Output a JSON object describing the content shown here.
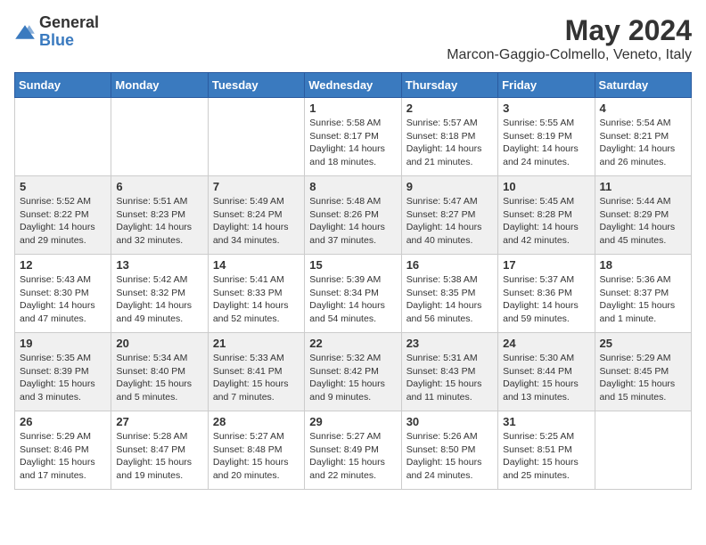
{
  "logo": {
    "general": "General",
    "blue": "Blue"
  },
  "title": "May 2024",
  "location": "Marcon-Gaggio-Colmello, Veneto, Italy",
  "days_of_week": [
    "Sunday",
    "Monday",
    "Tuesday",
    "Wednesday",
    "Thursday",
    "Friday",
    "Saturday"
  ],
  "weeks": [
    [
      {
        "day": "",
        "info": ""
      },
      {
        "day": "",
        "info": ""
      },
      {
        "day": "",
        "info": ""
      },
      {
        "day": "1",
        "info": "Sunrise: 5:58 AM\nSunset: 8:17 PM\nDaylight: 14 hours\nand 18 minutes."
      },
      {
        "day": "2",
        "info": "Sunrise: 5:57 AM\nSunset: 8:18 PM\nDaylight: 14 hours\nand 21 minutes."
      },
      {
        "day": "3",
        "info": "Sunrise: 5:55 AM\nSunset: 8:19 PM\nDaylight: 14 hours\nand 24 minutes."
      },
      {
        "day": "4",
        "info": "Sunrise: 5:54 AM\nSunset: 8:21 PM\nDaylight: 14 hours\nand 26 minutes."
      }
    ],
    [
      {
        "day": "5",
        "info": "Sunrise: 5:52 AM\nSunset: 8:22 PM\nDaylight: 14 hours\nand 29 minutes."
      },
      {
        "day": "6",
        "info": "Sunrise: 5:51 AM\nSunset: 8:23 PM\nDaylight: 14 hours\nand 32 minutes."
      },
      {
        "day": "7",
        "info": "Sunrise: 5:49 AM\nSunset: 8:24 PM\nDaylight: 14 hours\nand 34 minutes."
      },
      {
        "day": "8",
        "info": "Sunrise: 5:48 AM\nSunset: 8:26 PM\nDaylight: 14 hours\nand 37 minutes."
      },
      {
        "day": "9",
        "info": "Sunrise: 5:47 AM\nSunset: 8:27 PM\nDaylight: 14 hours\nand 40 minutes."
      },
      {
        "day": "10",
        "info": "Sunrise: 5:45 AM\nSunset: 8:28 PM\nDaylight: 14 hours\nand 42 minutes."
      },
      {
        "day": "11",
        "info": "Sunrise: 5:44 AM\nSunset: 8:29 PM\nDaylight: 14 hours\nand 45 minutes."
      }
    ],
    [
      {
        "day": "12",
        "info": "Sunrise: 5:43 AM\nSunset: 8:30 PM\nDaylight: 14 hours\nand 47 minutes."
      },
      {
        "day": "13",
        "info": "Sunrise: 5:42 AM\nSunset: 8:32 PM\nDaylight: 14 hours\nand 49 minutes."
      },
      {
        "day": "14",
        "info": "Sunrise: 5:41 AM\nSunset: 8:33 PM\nDaylight: 14 hours\nand 52 minutes."
      },
      {
        "day": "15",
        "info": "Sunrise: 5:39 AM\nSunset: 8:34 PM\nDaylight: 14 hours\nand 54 minutes."
      },
      {
        "day": "16",
        "info": "Sunrise: 5:38 AM\nSunset: 8:35 PM\nDaylight: 14 hours\nand 56 minutes."
      },
      {
        "day": "17",
        "info": "Sunrise: 5:37 AM\nSunset: 8:36 PM\nDaylight: 14 hours\nand 59 minutes."
      },
      {
        "day": "18",
        "info": "Sunrise: 5:36 AM\nSunset: 8:37 PM\nDaylight: 15 hours\nand 1 minute."
      }
    ],
    [
      {
        "day": "19",
        "info": "Sunrise: 5:35 AM\nSunset: 8:39 PM\nDaylight: 15 hours\nand 3 minutes."
      },
      {
        "day": "20",
        "info": "Sunrise: 5:34 AM\nSunset: 8:40 PM\nDaylight: 15 hours\nand 5 minutes."
      },
      {
        "day": "21",
        "info": "Sunrise: 5:33 AM\nSunset: 8:41 PM\nDaylight: 15 hours\nand 7 minutes."
      },
      {
        "day": "22",
        "info": "Sunrise: 5:32 AM\nSunset: 8:42 PM\nDaylight: 15 hours\nand 9 minutes."
      },
      {
        "day": "23",
        "info": "Sunrise: 5:31 AM\nSunset: 8:43 PM\nDaylight: 15 hours\nand 11 minutes."
      },
      {
        "day": "24",
        "info": "Sunrise: 5:30 AM\nSunset: 8:44 PM\nDaylight: 15 hours\nand 13 minutes."
      },
      {
        "day": "25",
        "info": "Sunrise: 5:29 AM\nSunset: 8:45 PM\nDaylight: 15 hours\nand 15 minutes."
      }
    ],
    [
      {
        "day": "26",
        "info": "Sunrise: 5:29 AM\nSunset: 8:46 PM\nDaylight: 15 hours\nand 17 minutes."
      },
      {
        "day": "27",
        "info": "Sunrise: 5:28 AM\nSunset: 8:47 PM\nDaylight: 15 hours\nand 19 minutes."
      },
      {
        "day": "28",
        "info": "Sunrise: 5:27 AM\nSunset: 8:48 PM\nDaylight: 15 hours\nand 20 minutes."
      },
      {
        "day": "29",
        "info": "Sunrise: 5:27 AM\nSunset: 8:49 PM\nDaylight: 15 hours\nand 22 minutes."
      },
      {
        "day": "30",
        "info": "Sunrise: 5:26 AM\nSunset: 8:50 PM\nDaylight: 15 hours\nand 24 minutes."
      },
      {
        "day": "31",
        "info": "Sunrise: 5:25 AM\nSunset: 8:51 PM\nDaylight: 15 hours\nand 25 minutes."
      },
      {
        "day": "",
        "info": ""
      }
    ]
  ],
  "shaded_weeks": [
    1,
    3
  ],
  "colors": {
    "header_bg": "#3a7abf",
    "shaded_row": "#f0f0f0"
  }
}
